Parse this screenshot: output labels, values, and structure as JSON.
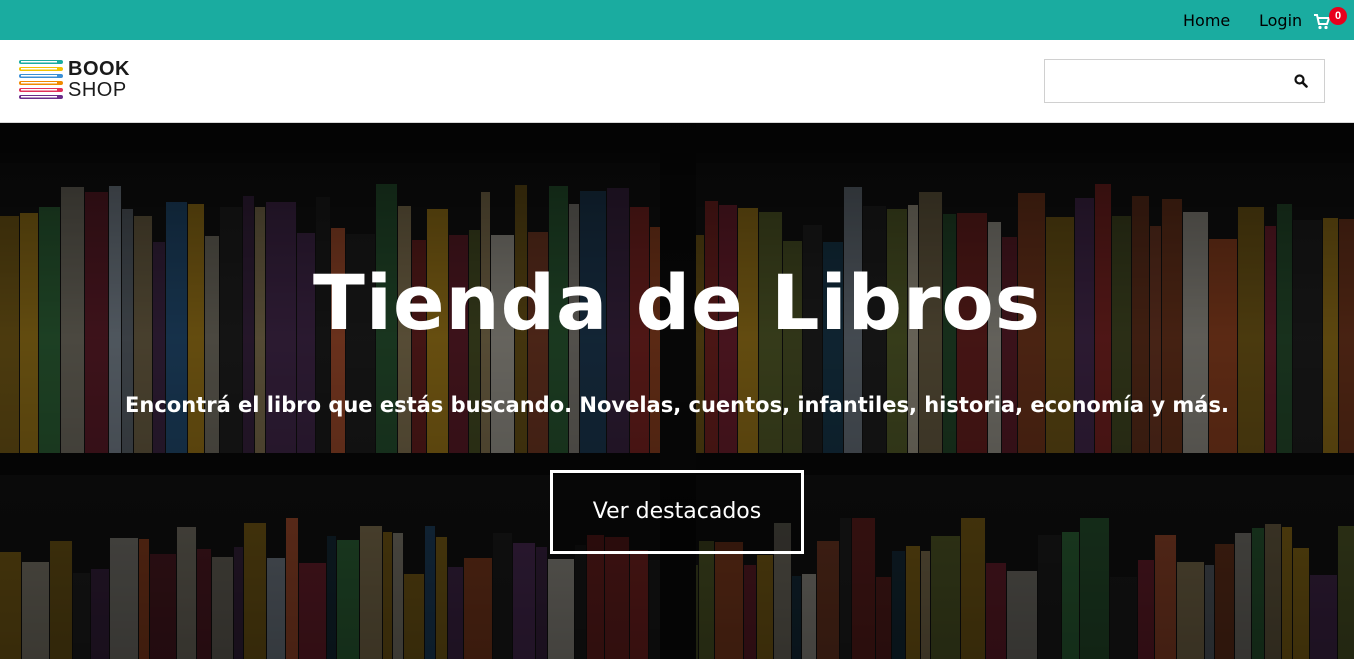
{
  "topbar": {
    "color": "#1aaca0",
    "home_label": "Home",
    "login_label": "Login",
    "cart_icon": "cart-icon",
    "cart_count": "0"
  },
  "header": {
    "logo_line1": "BOOK",
    "logo_line2": "SHOP",
    "search": {
      "placeholder": "",
      "value": "",
      "icon": "search-icon"
    }
  },
  "hero": {
    "title": "Tienda de Libros",
    "subtitle": "Encontrá el libro que estás buscando. Novelas, cuentos, infantiles, historia, economía y más.",
    "button_label": "Ver destacados"
  }
}
